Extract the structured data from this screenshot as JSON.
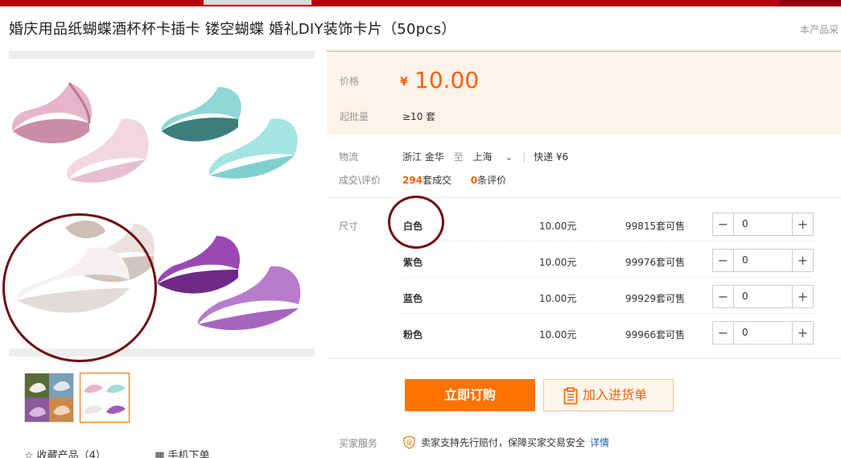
{
  "page": {
    "title": "婚庆用品纸蝴蝶酒杯杯卡插卡 镂空蝴蝶 婚礼DIY装饰卡片（50pcs）",
    "title_right": "本产品采"
  },
  "price": {
    "label": "价格",
    "currency": "¥",
    "value": "10.00",
    "min_label": "起批量",
    "min_value": "≥10 套"
  },
  "logistics": {
    "label": "物流",
    "from": "浙江 金华",
    "to_word": "至",
    "to": "上海",
    "shipping": "快递 ¥6"
  },
  "trade": {
    "label": "成交\\评价",
    "deals_count": "294",
    "deals_unit": "套成交",
    "reviews_count": "0",
    "reviews_unit": "条评价"
  },
  "sku": {
    "label": "尺寸",
    "rows": [
      {
        "name": "白色",
        "price": "10.00元",
        "stock": "99815套可售",
        "qty": "0"
      },
      {
        "name": "紫色",
        "price": "10.00元",
        "stock": "99976套可售",
        "qty": "0"
      },
      {
        "name": "蓝色",
        "price": "10.00元",
        "stock": "99929套可售",
        "qty": "0"
      },
      {
        "name": "粉色",
        "price": "10.00元",
        "stock": "99966套可售",
        "qty": "0"
      }
    ]
  },
  "buttons": {
    "buy": "立即订购",
    "cart": "加入进货单"
  },
  "service": {
    "label": "买家服务",
    "text": "卖家支持先行赔付，保障买家交易安全",
    "link": "详情"
  },
  "actions": {
    "favorite": "收藏产品（4）",
    "mobile": "手机下单"
  },
  "colors": {
    "accent": "#ff6000",
    "button": "#ff7300",
    "topbar": "#b3000d",
    "annotation_ring": "#6e0d15"
  }
}
